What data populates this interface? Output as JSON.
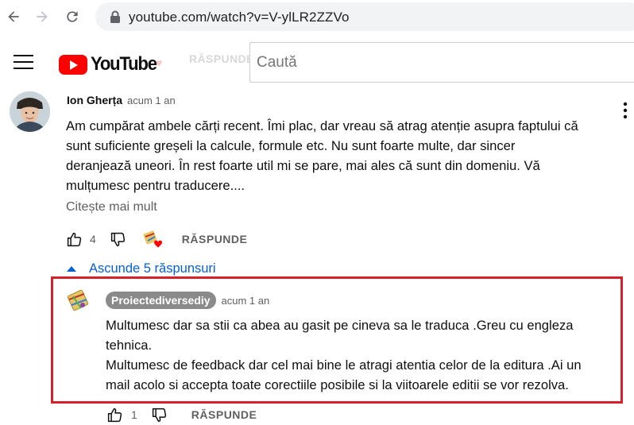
{
  "browser": {
    "url": "youtube.com/watch?v=V-ylLR2ZZVo"
  },
  "header": {
    "logo_text": "YouTube",
    "ghost_label": "RĂSPUNDE",
    "search_placeholder": "Caută"
  },
  "comment": {
    "author": "Ion Gherța",
    "time": "acum 1 an",
    "lines": [
      "Am cumpărat ambele cărți recent. Îmi plac, dar vreau să atrag atenție asupra faptului că",
      "sunt suficiente greșeli la calcule, formule etc. Nu sunt foarte multe, dar sincer",
      "deranjează uneori. În rest foarte util mi se pare, mai ales că sunt din domeniu. Vă",
      "mulțumesc pentru traducere...."
    ],
    "read_more": "Citește mai mult",
    "likes": "4",
    "reply_label": "RĂSPUNDE",
    "hide_replies": "Ascunde 5 răspunsuri"
  },
  "reply": {
    "author": "Proiectediversediy",
    "time": "acum 1 an",
    "lines": [
      "Multumesc dar sa stii ca abea au gasit pe cineva sa le traduca .Greu cu engleza",
      "tehnica.",
      "Multumesc de feedback dar cel mai bine le atragi atentia celor de la editura .Ai un",
      "mail acolo si accepta toate corectiile posibile si la viitoarele editii se vor rezolva."
    ],
    "likes": "1",
    "reply_label": "RĂSPUNDE"
  },
  "colors": {
    "highlight_border": "#d6202b",
    "link_blue": "#065fd4",
    "yt_red": "#ff0000",
    "chip_gray": "#8a8a8a"
  }
}
